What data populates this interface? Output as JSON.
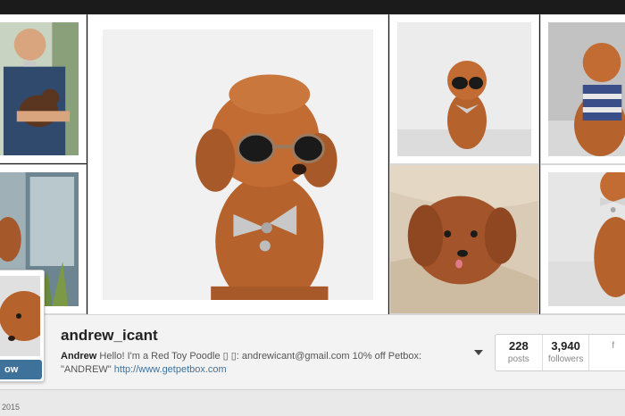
{
  "profile": {
    "username": "andrew_icant",
    "bio_name": "Andrew",
    "bio_text": " Hello! I'm a Red Toy Poodle ▯ ▯: andrewicant@gmail.com 10% off Petbox: \"ANDREW\" ",
    "bio_link": "http://www.getpetbox.com",
    "follow_label": "ow"
  },
  "stats": [
    {
      "count": "228",
      "label": "posts"
    },
    {
      "count": "3,940",
      "label": "followers"
    },
    {
      "count": "",
      "label": "f"
    }
  ],
  "footer": {
    "year_text": "2015"
  },
  "colors": {
    "accent": "#3f729b",
    "poodle": "#b5622c"
  }
}
